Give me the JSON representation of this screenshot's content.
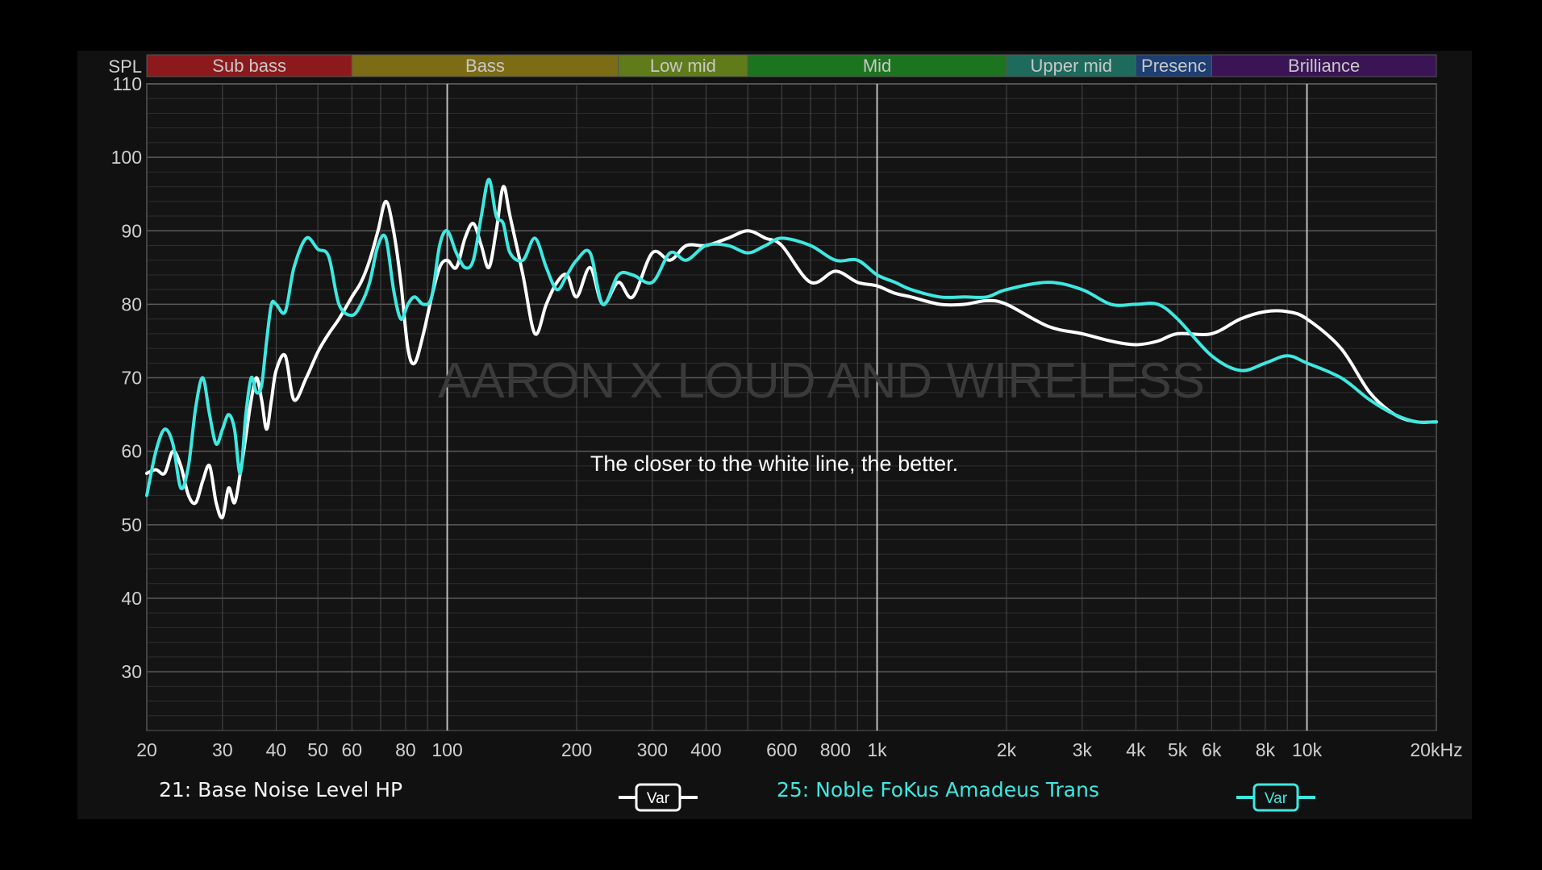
{
  "chart_data": {
    "type": "line",
    "ylabel": "SPL",
    "xunit": "kHz",
    "xscale": "log",
    "xlim": [
      20,
      20000
    ],
    "ylim": [
      22,
      110
    ],
    "grid": true,
    "watermark": "AARON X LOUD AND WIRELESS",
    "annotation": "The closer to the white line, the better.",
    "y_ticks": [
      110,
      100,
      90,
      80,
      70,
      60,
      50,
      40,
      30
    ],
    "x_ticks": [
      {
        "v": 20,
        "label": "20"
      },
      {
        "v": 30,
        "label": "30"
      },
      {
        "v": 40,
        "label": "40"
      },
      {
        "v": 50,
        "label": "50"
      },
      {
        "v": 60,
        "label": "60"
      },
      {
        "v": 80,
        "label": "80"
      },
      {
        "v": 100,
        "label": "100"
      },
      {
        "v": 200,
        "label": "200"
      },
      {
        "v": 300,
        "label": "300"
      },
      {
        "v": 400,
        "label": "400"
      },
      {
        "v": 600,
        "label": "600"
      },
      {
        "v": 800,
        "label": "800"
      },
      {
        "v": 1000,
        "label": "1k"
      },
      {
        "v": 2000,
        "label": "2k"
      },
      {
        "v": 3000,
        "label": "3k"
      },
      {
        "v": 4000,
        "label": "4k"
      },
      {
        "v": 5000,
        "label": "5k"
      },
      {
        "v": 6000,
        "label": "6k"
      },
      {
        "v": 8000,
        "label": "8k"
      },
      {
        "v": 10000,
        "label": "10k"
      },
      {
        "v": 20000,
        "label": "20kHz"
      }
    ],
    "bands": [
      {
        "label": "Sub bass",
        "from": 20,
        "to": 60,
        "color": "#8c1a1d"
      },
      {
        "label": "Bass",
        "from": 60,
        "to": 250,
        "color": "#7d6c16"
      },
      {
        "label": "Low mid",
        "from": 250,
        "to": 500,
        "color": "#607b1a"
      },
      {
        "label": "Mid",
        "from": 500,
        "to": 2000,
        "color": "#1d741f"
      },
      {
        "label": "Upper mid",
        "from": 2000,
        "to": 4000,
        "color": "#1e6b5e"
      },
      {
        "label": "Presenc",
        "from": 4000,
        "to": 6000,
        "color": "#1d3f73"
      },
      {
        "label": "Brilliance",
        "from": 6000,
        "to": 20000,
        "color": "#3a1454"
      }
    ],
    "series": [
      {
        "name": "21: Base Noise Level HP",
        "color": "#ffffff",
        "x": [
          20,
          21,
          22,
          23,
          24,
          25,
          26,
          27,
          28,
          29,
          30,
          31,
          32,
          33,
          34,
          35,
          36,
          37,
          38,
          39,
          40,
          42,
          44,
          47,
          50,
          53,
          56,
          60,
          63,
          66,
          69,
          72,
          75,
          78,
          81,
          84,
          88,
          92,
          96,
          100,
          105,
          110,
          115,
          120,
          125,
          130,
          135,
          140,
          150,
          160,
          170,
          180,
          190,
          200,
          215,
          230,
          250,
          270,
          300,
          330,
          360,
          400,
          450,
          500,
          550,
          600,
          700,
          800,
          900,
          1000,
          1100,
          1200,
          1400,
          1600,
          1800,
          2000,
          2500,
          3000,
          3500,
          4000,
          4500,
          5000,
          6000,
          7000,
          8000,
          9000,
          10000,
          12000,
          14000,
          16000,
          18000,
          20000
        ],
        "y": [
          57,
          57.5,
          57,
          60,
          58,
          54,
          53,
          56,
          58,
          53,
          51,
          55,
          53,
          57,
          62,
          67,
          70,
          67,
          63,
          67,
          71,
          73,
          67,
          70,
          73.5,
          76,
          78,
          81,
          83,
          86,
          90,
          94,
          90,
          83,
          74,
          72,
          76,
          81,
          85,
          86,
          85,
          89,
          91,
          88,
          85,
          90,
          96,
          92,
          84,
          76,
          80,
          83,
          84,
          81,
          85,
          80,
          83,
          81,
          87,
          86,
          88,
          88,
          89,
          90,
          89,
          88,
          83,
          84.5,
          83,
          82.5,
          81.5,
          81,
          80,
          80,
          80.5,
          80,
          77,
          76,
          75,
          74.5,
          75,
          76,
          76,
          78,
          79,
          79,
          78,
          74,
          68,
          65,
          64,
          64
        ]
      },
      {
        "name": "25: Noble FoKus Amadeus Trans",
        "color": "#3ee8e0",
        "x": [
          20,
          21,
          22,
          23,
          24,
          25,
          26,
          27,
          28,
          29,
          30,
          31,
          32,
          33,
          34,
          35,
          36,
          37,
          38,
          39,
          40,
          42,
          44,
          47,
          50,
          53,
          56,
          60,
          63,
          66,
          69,
          72,
          75,
          78,
          81,
          84,
          88,
          92,
          96,
          100,
          105,
          110,
          115,
          120,
          125,
          130,
          135,
          140,
          150,
          160,
          170,
          180,
          190,
          200,
          215,
          230,
          250,
          270,
          300,
          330,
          360,
          400,
          450,
          500,
          550,
          600,
          700,
          800,
          900,
          1000,
          1100,
          1200,
          1400,
          1600,
          1800,
          2000,
          2500,
          3000,
          3500,
          4000,
          4500,
          5000,
          6000,
          7000,
          8000,
          9000,
          10000,
          12000,
          14000,
          16000,
          18000,
          20000
        ],
        "y": [
          54,
          60,
          63,
          61,
          55,
          58,
          66,
          70,
          65,
          61,
          63,
          65,
          63,
          57,
          65,
          70,
          68,
          69,
          75,
          80,
          80,
          79,
          85,
          89,
          87.5,
          86.5,
          80,
          78.5,
          80,
          83,
          88,
          89,
          82,
          78,
          80,
          81,
          80,
          81,
          88,
          90,
          87,
          85,
          86,
          92,
          97,
          92,
          91,
          87,
          86,
          89,
          85,
          82,
          84,
          86,
          87,
          80,
          84,
          84,
          83,
          87,
          86,
          88,
          88,
          87,
          88,
          89,
          88,
          86,
          86,
          84,
          83,
          82,
          81,
          81,
          81,
          82,
          83,
          82,
          80,
          80,
          80,
          78,
          73,
          71,
          72,
          73,
          72,
          70,
          67,
          65,
          64,
          64
        ]
      }
    ]
  },
  "legend": {
    "item1": {
      "label": "21: Base Noise Level HP",
      "button": "Var"
    },
    "item2": {
      "label": "25: Noble FoKus Amadeus Trans",
      "button": "Var"
    }
  }
}
